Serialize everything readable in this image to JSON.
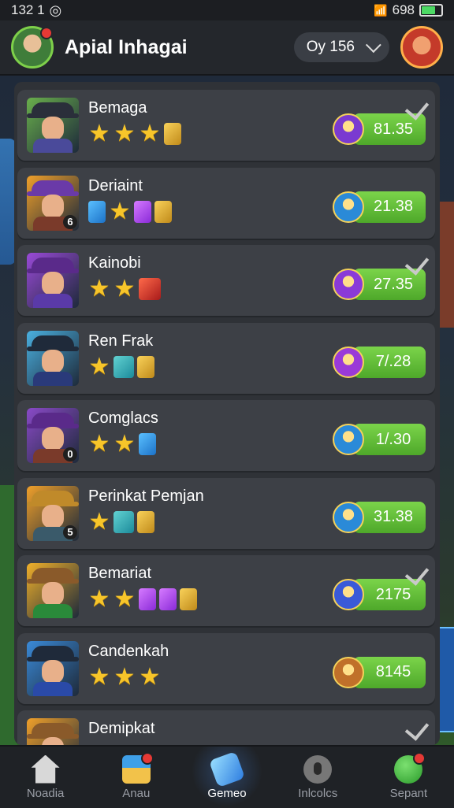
{
  "status_bar": {
    "time": "132 1",
    "battery": "698",
    "battery_fraction": 0.85
  },
  "header": {
    "title": "Apial Inhagai",
    "dropdown_value": "Oy 156"
  },
  "rows": [
    {
      "name": "Bemaga",
      "score": "81.35",
      "checked": true,
      "num": "",
      "hat": "#2a2f3a",
      "bg": "#6ab04c",
      "shirt": "#4a4a9a",
      "emblem": "#7a3ad0",
      "tokens": [
        "star",
        "star",
        "star",
        "gold"
      ]
    },
    {
      "name": "Deriaint",
      "score": "21.38",
      "checked": false,
      "num": "6",
      "hat": "#6a3aa8",
      "bg": "#f0a02a",
      "shirt": "#7a3a2a",
      "emblem": "#2a8ad8",
      "tokens": [
        "blue",
        "star",
        "purple",
        "gold"
      ]
    },
    {
      "name": "Kainobi",
      "score": "27.35",
      "checked": true,
      "num": "",
      "hat": "#5a2a8a",
      "bg": "#9a4ad8",
      "shirt": "#5a3aa8",
      "emblem": "#8a3ad8",
      "tokens": [
        "star",
        "star",
        "red"
      ]
    },
    {
      "name": "Ren Frak",
      "score": "7/.28",
      "checked": false,
      "num": "",
      "hat": "#1f2a3a",
      "bg": "#4ab0e0",
      "shirt": "#2a3a7a",
      "emblem": "#9a3ad8",
      "tokens": [
        "star",
        "teal",
        "gold"
      ]
    },
    {
      "name": "Comglacs",
      "score": "1/.30",
      "checked": false,
      "num": "0",
      "hat": "#5a2a8a",
      "bg": "#8a4ac8",
      "shirt": "#7a3a2a",
      "emblem": "#2a8ad8",
      "tokens": [
        "star",
        "star",
        "blue"
      ]
    },
    {
      "name": "Perinkat Pemjan",
      "score": "31.38",
      "checked": false,
      "num": "5",
      "hat": "#c08a2a",
      "bg": "#f0a02a",
      "shirt": "#3a5a6a",
      "emblem": "#2a8ad8",
      "tokens": [
        "star",
        "teal",
        "gold"
      ]
    },
    {
      "name": "Bemariat",
      "score": "2175",
      "checked": true,
      "num": "",
      "hat": "#8a5a2a",
      "bg": "#f0b02a",
      "shirt": "#2a8a3a",
      "emblem": "#3a5ad8",
      "tokens": [
        "star",
        "star",
        "purple",
        "purple",
        "gold"
      ]
    },
    {
      "name": "Candenkah",
      "score": "8145",
      "checked": false,
      "num": "",
      "hat": "#1f2a3a",
      "bg": "#3a8ad8",
      "shirt": "#2a4aa8",
      "emblem": "#c0702a",
      "tokens": [
        "star",
        "star",
        "star"
      ]
    },
    {
      "name": "Demipkat",
      "score": "",
      "checked": true,
      "num": "",
      "hat": "#8a5a2a",
      "bg": "#f0a02a",
      "shirt": "#7a3a2a",
      "emblem": "#3a5ad8",
      "tokens": []
    }
  ],
  "nav": [
    {
      "label": "Noadia",
      "icon": "home-icon",
      "active": false,
      "badge": false
    },
    {
      "label": "Anau",
      "icon": "chest-icon",
      "active": false,
      "badge": true
    },
    {
      "label": "Gemeo",
      "icon": "game-icon",
      "active": true,
      "badge": false
    },
    {
      "label": "Inlcolcs",
      "icon": "lock-icon",
      "active": false,
      "badge": false
    },
    {
      "label": "Sepant",
      "icon": "ball-icon",
      "active": false,
      "badge": true
    }
  ]
}
